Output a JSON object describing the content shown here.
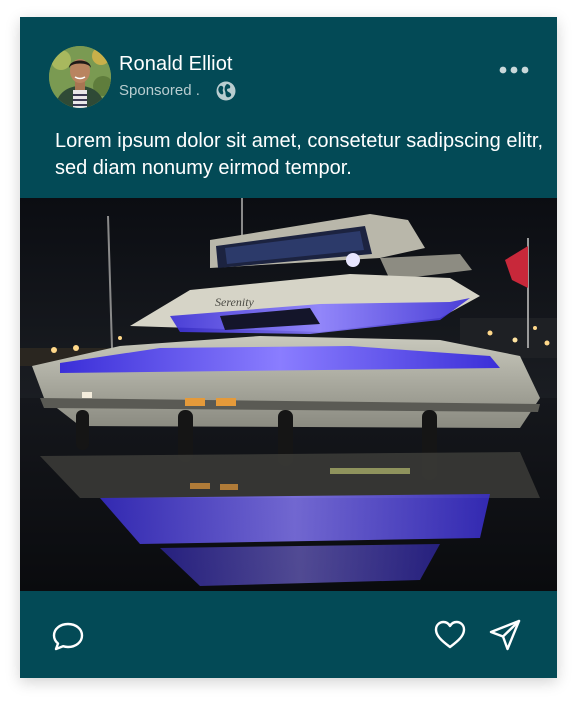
{
  "post": {
    "author": {
      "name": "Ronald Elliot"
    },
    "sponsored_label": "Sponsored .",
    "caption": "Lorem ipsum dolor sit amet, consetetur sadipscing elitr, sed diam nonumy eirmod tempor.",
    "image": {
      "subject": "yacht-at-night-photo",
      "boat_name": "Serenity"
    },
    "icons": {
      "audience": "globe-icon",
      "more": "more-horizontal-icon",
      "comment": "comment-icon",
      "like": "heart-icon",
      "share": "send-icon"
    }
  },
  "theme": {
    "card_background": "#034a56",
    "text_primary": "#ffffff",
    "text_secondary": "#b9cdd0"
  }
}
